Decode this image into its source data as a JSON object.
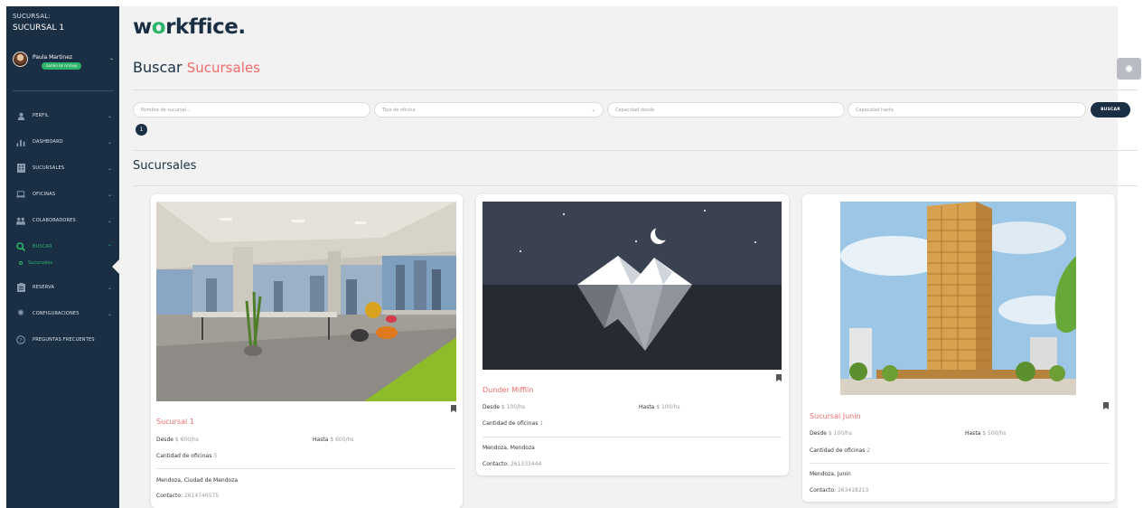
{
  "sidebar": {
    "branch_title": "SUCURSAL:",
    "branch_name": "SUCURSAL 1",
    "user_name": "Paula Martinez",
    "user_role": "DUEÑO DE OFICINA",
    "items": [
      {
        "label": "PERFIL",
        "icon": "user-icon"
      },
      {
        "label": "DASHBOARD",
        "icon": "bar-chart-icon"
      },
      {
        "label": "SUCURSALES",
        "icon": "building-icon"
      },
      {
        "label": "OFICINAS",
        "icon": "laptop-icon"
      },
      {
        "label": "COLABORADORES",
        "icon": "users-icon"
      },
      {
        "label": "BUSCAR",
        "icon": "search-icon"
      },
      {
        "label": "RESERVA",
        "icon": "clipboard-icon"
      },
      {
        "label": "CONFIGURACIONES",
        "icon": "gear-icon"
      },
      {
        "label": "PREGUNTAS FRECUENTES",
        "icon": "question-icon"
      }
    ],
    "active_subitem": "Sucursales"
  },
  "header": {
    "logo": "workffice.",
    "title_main": "Buscar",
    "title_accent": "Sucursales"
  },
  "filters": {
    "name_placeholder": "Nombre de sucursal...",
    "type_placeholder": "Tipo de oficina",
    "cap_from_placeholder": "Capacidad desde",
    "cap_to_placeholder": "Capacidad hasta",
    "search_label": "BUSCAR",
    "results_count": "1"
  },
  "section_title": "Sucursales",
  "labels": {
    "desde": "Desde",
    "hasta": "Hasta",
    "cantidad": "Cantidad de oficinas",
    "contacto": "Contacto:"
  },
  "cards": [
    {
      "name": "Sucursal 1",
      "desde": "$ 600/hs",
      "hasta": "$ 600/hs",
      "oficinas": "3",
      "location": "Mendoza, Ciudad de Mendoza",
      "contacto": "2614746575"
    },
    {
      "name": "Dunder Mifflin",
      "desde": "$ 100/hs",
      "hasta": "$ 100/hs",
      "oficinas": "1",
      "location": "Mendoza, Mendoza",
      "contacto": "261333444"
    },
    {
      "name": "Sucursal Junin",
      "desde": "$ 100/hs",
      "hasta": "$ 500/hs",
      "oficinas": "2",
      "location": "Mendoza, Junin",
      "contacto": "263418213"
    }
  ],
  "colors": {
    "sidebar_bg": "#1b2f44",
    "accent_green": "#2db36a",
    "accent_red": "#ef6b6b"
  }
}
